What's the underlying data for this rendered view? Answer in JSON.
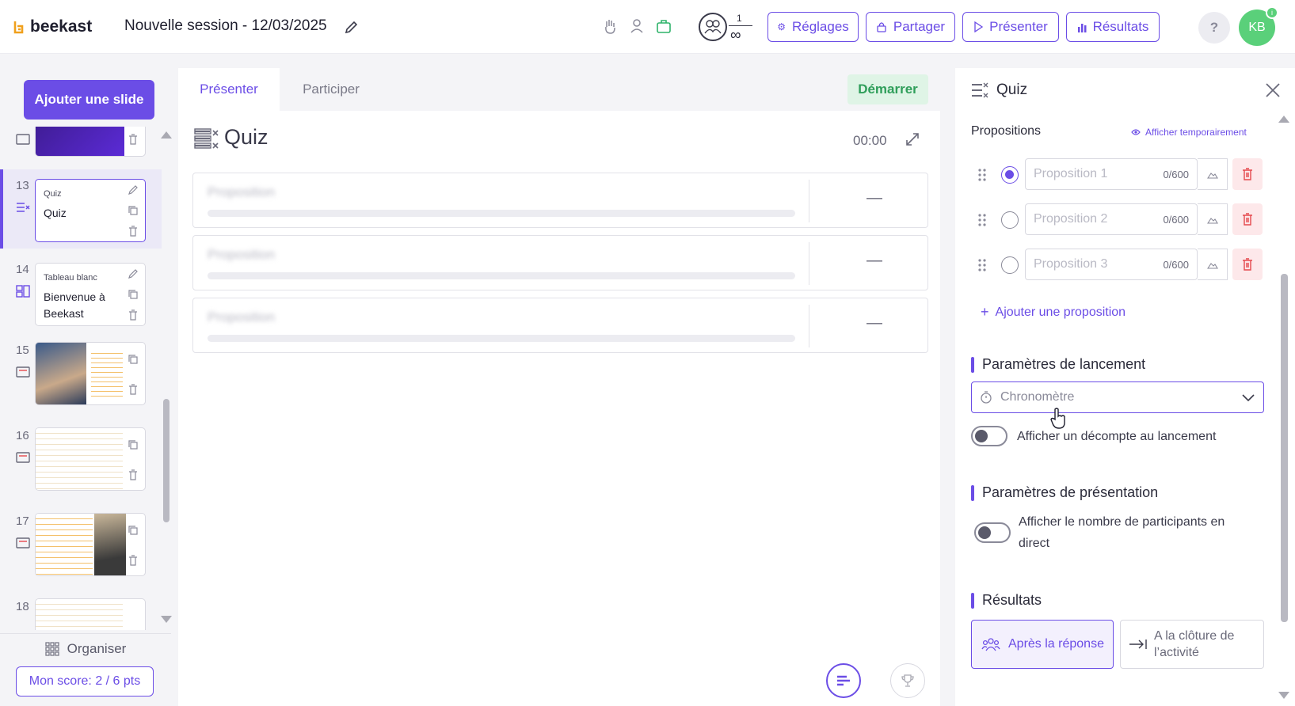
{
  "topbar": {
    "brand": "beekast",
    "session_title": "Nouvelle session - 12/03/2025",
    "participants_count": "1",
    "participants_max": "∞",
    "buttons": {
      "settings": "Réglages",
      "share": "Partager",
      "present": "Présenter",
      "results": "Résultats"
    },
    "help": "?",
    "avatar_initials": "KB",
    "avatar_badge": "i"
  },
  "sidebar": {
    "add_slide": "Ajouter une slide",
    "slides": [
      {
        "number": "",
        "kind": "",
        "title": ""
      },
      {
        "number": "13",
        "kind": "Quiz",
        "title": "Quiz"
      },
      {
        "number": "14",
        "kind": "Tableau blanc",
        "title": "Bienvenue à Beekast"
      },
      {
        "number": "15",
        "kind": "",
        "title": ""
      },
      {
        "number": "16",
        "kind": "",
        "title": ""
      },
      {
        "number": "17",
        "kind": "",
        "title": ""
      },
      {
        "number": "18",
        "kind": "",
        "title": ""
      }
    ],
    "organise": "Organiser",
    "score": "Mon score: 2 / 6 pts"
  },
  "center": {
    "tabs": [
      "Présenter",
      "Participer"
    ],
    "start": "Démarrer",
    "quiz_title": "Quiz",
    "timer": "00:00",
    "responses": [
      {
        "label": "Proposition",
        "value": "—"
      },
      {
        "label": "Proposition",
        "value": "—"
      },
      {
        "label": "Proposition",
        "value": "—"
      }
    ]
  },
  "panel": {
    "title": "Quiz",
    "propositions_label": "Propositions",
    "show_temporarily": "Afficher temporairement",
    "propositions": [
      {
        "placeholder": "Proposition 1",
        "counter": "0/600",
        "selected": true
      },
      {
        "placeholder": "Proposition 2",
        "counter": "0/600",
        "selected": false
      },
      {
        "placeholder": "Proposition 3",
        "counter": "0/600",
        "selected": false
      }
    ],
    "add_proposition": "Ajouter une proposition",
    "launch_params": "Paramètres de lancement",
    "timer_select": "Chronomètre",
    "countdown_toggle": "Afficher un décompte au lancement",
    "presentation_params": "Paramètres de présentation",
    "participants_toggle": "Afficher le nombre de participants en direct",
    "results_heading": "Résultats",
    "results_options": [
      "Après la réponse",
      "A la clôture de l’activité"
    ]
  },
  "colors": {
    "accent": "#6b4de6",
    "success": "#2f9e5a",
    "danger": "#e5484d",
    "avatar": "#5ad07a"
  }
}
